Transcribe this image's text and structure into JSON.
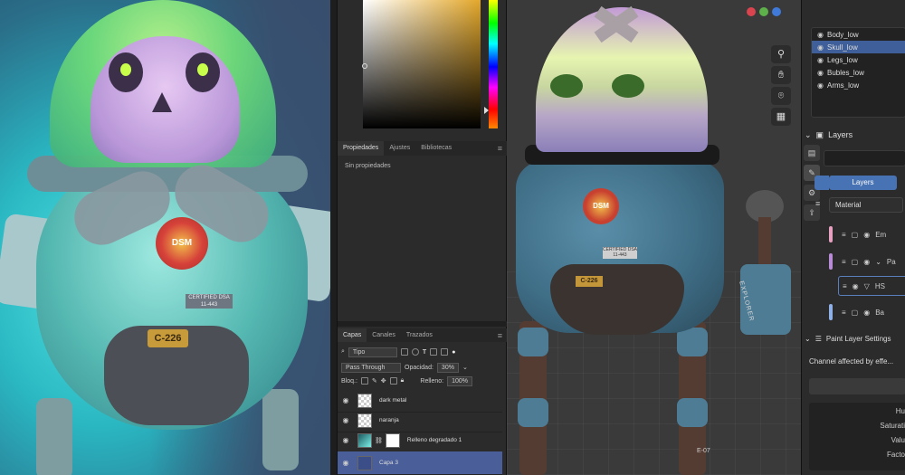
{
  "artwork": {
    "badge": "DSM",
    "plate": "C-226",
    "cert": "CERTIFIED DSA 11-443"
  },
  "photoshop": {
    "tabs": [
      "Propiedades",
      "Ajustes",
      "Bibliotecas"
    ],
    "no_props": "Sin propiedades",
    "layers_tabs": [
      "Capas",
      "Canales",
      "Trazados"
    ],
    "filter_kind": "Tipo",
    "blend_mode": "Pass Through",
    "opacity_label": "Opacidad:",
    "opacity_value": "30%",
    "lock_label": "Bloq.:",
    "fill_label": "Relleno:",
    "fill_value": "100%",
    "layers": [
      {
        "name": "dark metal",
        "selected": false
      },
      {
        "name": "naranja",
        "selected": false
      },
      {
        "name": "Relleno degradado 1",
        "selected": false
      },
      {
        "name": "Capa 3",
        "selected": true
      }
    ]
  },
  "viewport": {
    "badge": "DSM",
    "plate": "C-226",
    "cert": "CERTIFIED DSA 11-443",
    "arm_tag": "EXPLORER",
    "leg_tag": "E-07",
    "gizmo_colors": [
      "#d9444f",
      "#5db04a",
      "#3f7ad9",
      "#7a7a7a"
    ],
    "tools": [
      "magnify-icon",
      "hand-icon",
      "camera-icon",
      "grid-icon"
    ]
  },
  "right_panel": {
    "outliner": [
      "Body_low",
      "Skull_low",
      "Legs_low",
      "Bubles_low",
      "Arms_low"
    ],
    "selected_outliner": "Skull_low",
    "layers_header": "Layers",
    "layers_button": "Layers",
    "material": "Material",
    "layers": [
      {
        "name": "Em",
        "color": "#e8a0c0"
      },
      {
        "name": "Pa",
        "color": "#b98ad6"
      },
      {
        "name": "HS",
        "color": "#5a7fbd"
      },
      {
        "name": "Ba",
        "color": "#8fb0e6"
      }
    ],
    "paint_settings": "Paint Layer Settings",
    "channel_affected": "Channel affected by effe...",
    "props": [
      "Hu",
      "Saturati",
      "Valu",
      "Facto"
    ]
  }
}
